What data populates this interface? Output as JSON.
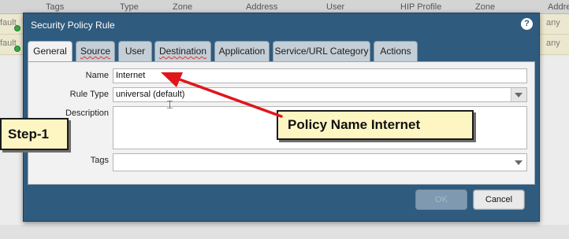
{
  "background": {
    "columns": [
      "Tags",
      "Type",
      "Zone",
      "Address",
      "User",
      "HIP Profile",
      "Zone",
      "Addre"
    ],
    "rows": [
      {
        "left_text": "fault",
        "right_text": "any"
      },
      {
        "left_text": "fault",
        "right_text": "any"
      }
    ]
  },
  "dialog": {
    "title": "Security Policy Rule",
    "help_icon": "?",
    "tabs": [
      {
        "label": "General"
      },
      {
        "label": "Source"
      },
      {
        "label": "User"
      },
      {
        "label": "Destination"
      },
      {
        "label": "Application"
      },
      {
        "label": "Service/URL Category"
      },
      {
        "label": "Actions"
      }
    ],
    "active_tab": "General",
    "fields": {
      "name": {
        "label": "Name",
        "value": "Internet"
      },
      "rule_type": {
        "label": "Rule Type",
        "value": "universal (default)"
      },
      "description": {
        "label": "Description",
        "value": ""
      },
      "tags": {
        "label": "Tags",
        "value": ""
      }
    },
    "buttons": {
      "ok": "OK",
      "cancel": "Cancel"
    }
  },
  "annotations": {
    "step": "Step-1",
    "policy": "Policy Name Internet",
    "arrow_color": "#e0161b"
  }
}
